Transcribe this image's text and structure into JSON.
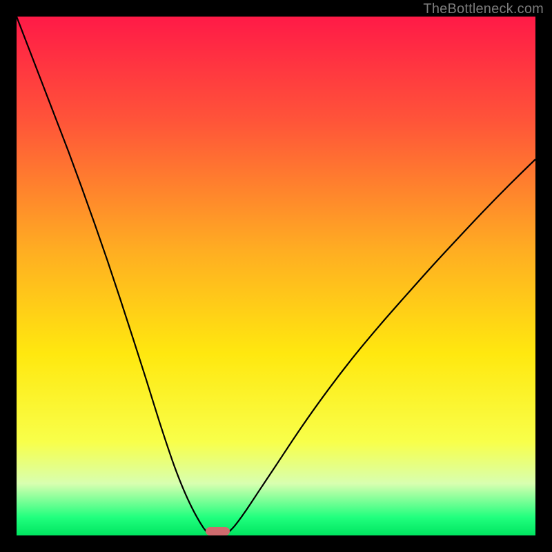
{
  "watermark": "TheBottleneck.com",
  "chart_data": {
    "type": "line",
    "title": "",
    "xlabel": "",
    "ylabel": "",
    "xlim": [
      0,
      100
    ],
    "ylim": [
      0,
      100
    ],
    "background_gradient_stops": [
      {
        "pos": 0.0,
        "color": "#ff1a47"
      },
      {
        "pos": 0.2,
        "color": "#ff5439"
      },
      {
        "pos": 0.45,
        "color": "#ffad22"
      },
      {
        "pos": 0.65,
        "color": "#ffe80f"
      },
      {
        "pos": 0.82,
        "color": "#f8ff4a"
      },
      {
        "pos": 0.9,
        "color": "#d8ffb0"
      },
      {
        "pos": 0.965,
        "color": "#21ff7e"
      },
      {
        "pos": 1.0,
        "color": "#00e560"
      }
    ],
    "series": [
      {
        "name": "curve-left",
        "x": [
          0.0,
          2.5,
          5.0,
          7.5,
          10.0,
          12.5,
          15.0,
          17.5,
          20.0,
          22.5,
          25.0,
          27.5,
          30.0,
          31.5,
          33.0,
          34.5,
          36.0,
          37.0
        ],
        "y": [
          100.0,
          93.5,
          87.0,
          80.5,
          74.0,
          67.2,
          60.2,
          53.0,
          45.5,
          37.8,
          30.0,
          22.0,
          14.5,
          10.5,
          7.0,
          4.0,
          1.5,
          0.3
        ]
      },
      {
        "name": "curve-right",
        "x": [
          40.5,
          42.0,
          44.0,
          47.0,
          50.0,
          55.0,
          60.0,
          65.0,
          70.0,
          75.0,
          80.0,
          85.0,
          90.0,
          95.0,
          100.0
        ],
        "y": [
          0.3,
          1.8,
          4.5,
          9.0,
          13.5,
          21.0,
          28.0,
          34.5,
          40.5,
          46.2,
          51.8,
          57.2,
          62.5,
          67.6,
          72.5
        ]
      }
    ],
    "marker": {
      "x": 38.8,
      "y": 0.8,
      "width": 4.6,
      "height": 1.7,
      "color": "#cf6b6e"
    }
  }
}
